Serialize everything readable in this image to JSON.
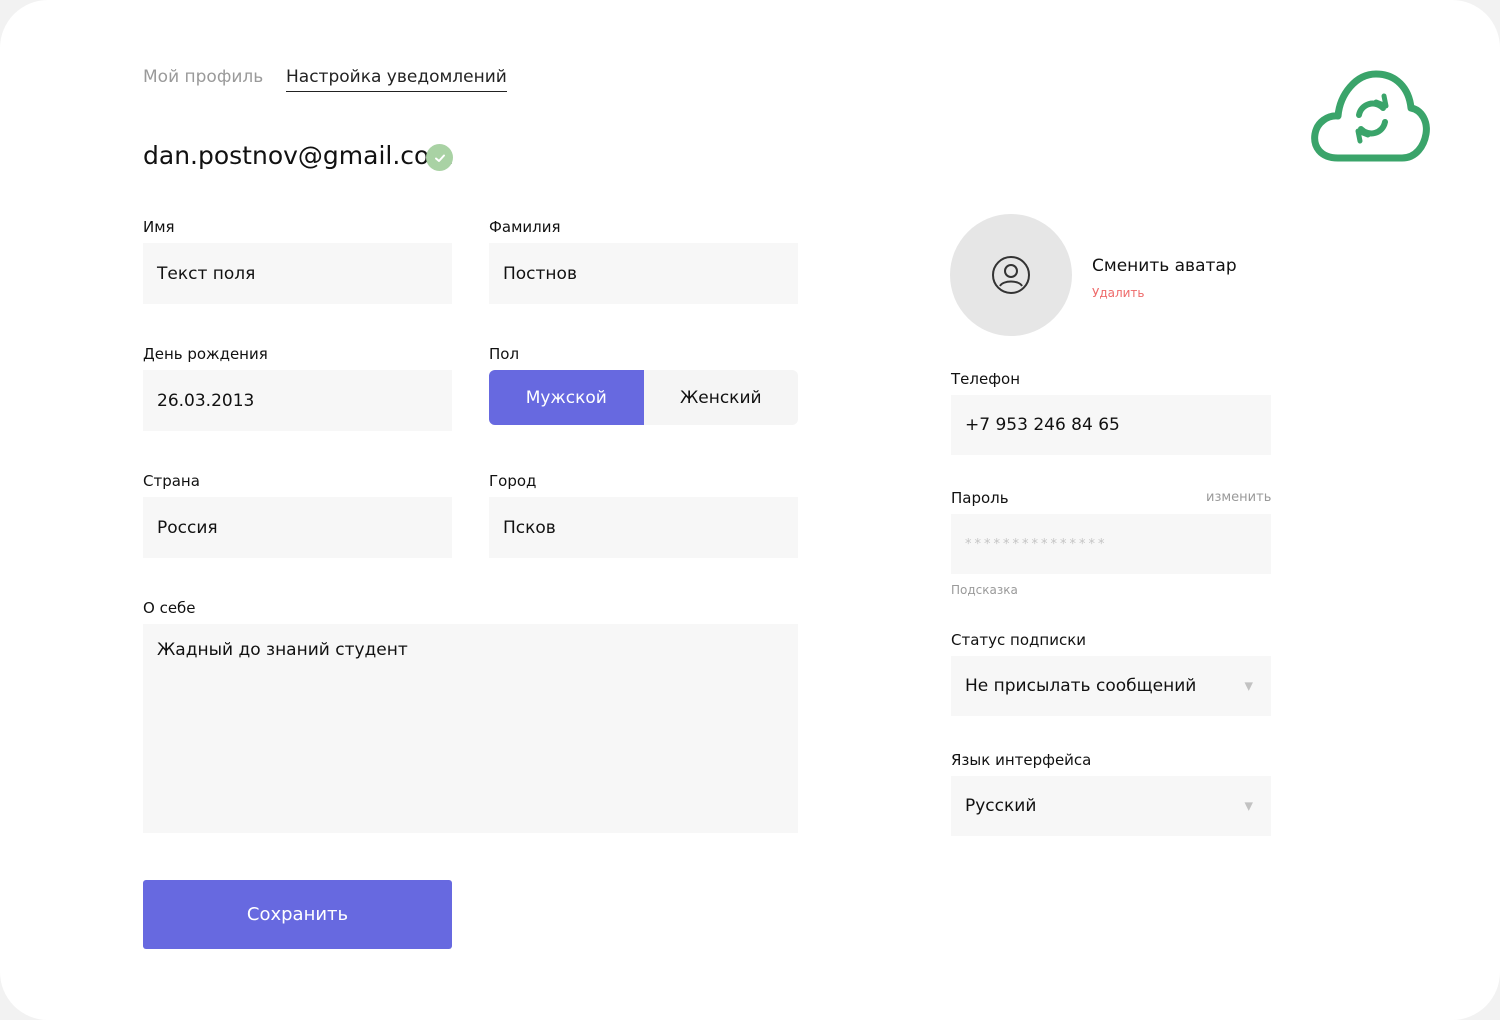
{
  "tabs": [
    {
      "label": "Мой профиль",
      "active": false
    },
    {
      "label": "Настройка уведомлений",
      "active": true
    }
  ],
  "email": "dan.postnov@gmail.com",
  "form": {
    "first_name": {
      "label": "Имя",
      "value": "Текст поля"
    },
    "last_name": {
      "label": "Фамилия",
      "value": "Постнов"
    },
    "birthday": {
      "label": "День рождения",
      "value": "26.03.2013"
    },
    "gender": {
      "label": "Пол",
      "options": [
        "Мужской",
        "Женский"
      ],
      "selected": "Мужской"
    },
    "country": {
      "label": "Страна",
      "value": "Россия"
    },
    "city": {
      "label": "Город",
      "value": "Псков"
    },
    "about": {
      "label": "О себе",
      "value": "Жадный до знаний студент"
    },
    "save_label": "Сохранить"
  },
  "profile": {
    "change_avatar": "Сменить аватар",
    "delete": "Удалить",
    "phone": {
      "label": "Телефон",
      "value": "+7 953 246 84 65"
    },
    "password": {
      "label": "Пароль",
      "change": "изменить",
      "value": "***************",
      "hint": "Подсказка"
    },
    "subscription": {
      "label": "Статус подписки",
      "value": "Не присылать сообщений"
    },
    "language": {
      "label": "Язык интерфейса",
      "value": "Русский"
    }
  },
  "colors": {
    "accent": "#6769e0",
    "danger": "#ee6a6a",
    "brand_green": "#3aa46a",
    "verified": "#a9d2a4"
  },
  "icons": {
    "logo": "cloud-sync-icon",
    "verified": "check-icon",
    "avatar": "user-icon",
    "dropdown": "triangle-down-icon"
  }
}
